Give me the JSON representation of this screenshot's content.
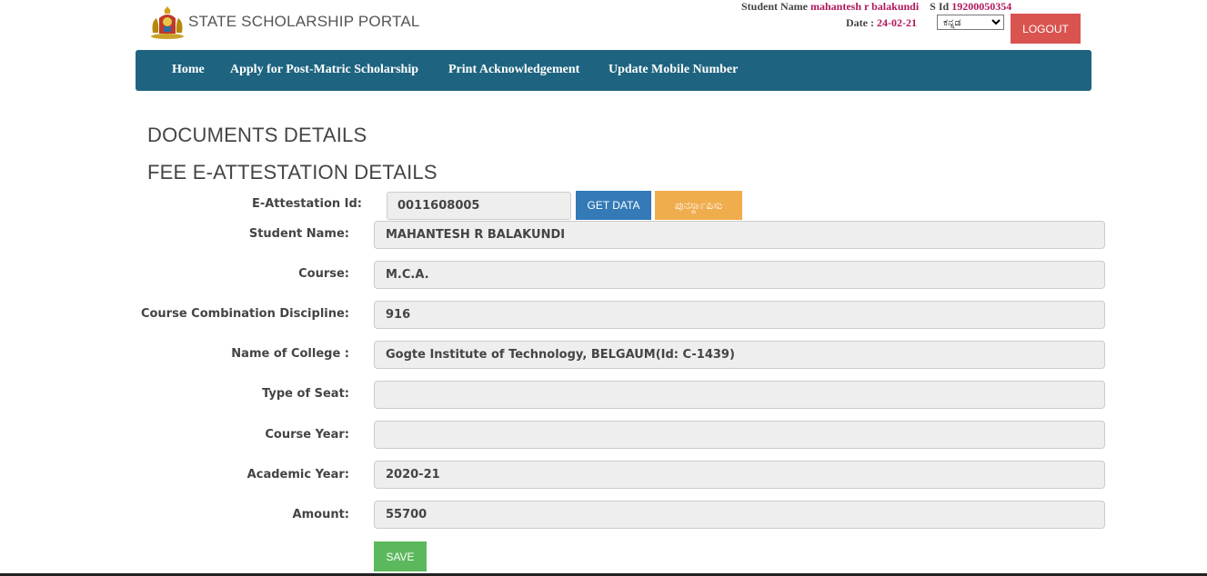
{
  "header": {
    "brand": "STATE SCHOLARSHIP PORTAL",
    "student_name_label": "Student Name",
    "student_name": "mahantesh r balakundi",
    "sid_label": "S Id",
    "sid": "19200050354",
    "date_label": "Date :",
    "date": "24-02-21",
    "language_selected": "ಕನ್ನಡ",
    "logout_label": "LOGOUT"
  },
  "nav": {
    "items": [
      {
        "label": "Home"
      },
      {
        "label": "Apply for Post-Matric Scholarship"
      },
      {
        "label": "Print Acknowledgement"
      },
      {
        "label": "Update Mobile Number"
      }
    ]
  },
  "main": {
    "documents_heading": "DOCUMENTS DETAILS",
    "fee_heading": "FEE E-ATTESTATION DETAILS",
    "attestation_label": "E-Attestation Id:",
    "attestation_value": "0011608005",
    "get_data_label": "GET DATA",
    "reset_label": "ಪುನರ್ಸ್ಥಾಪಿಸು",
    "fields": [
      {
        "label": "Student Name:",
        "value": "MAHANTESH R BALAKUNDI"
      },
      {
        "label": "Course:",
        "value": "M.C.A."
      },
      {
        "label": "Course Combination Discipline:",
        "value": "916"
      },
      {
        "label": "Name of College :",
        "value": "Gogte Institute of Technology, BELGAUM(Id: C-1439)"
      },
      {
        "label": "Type of Seat:",
        "value": ""
      },
      {
        "label": "Course Year:",
        "value": ""
      },
      {
        "label": "Academic Year:",
        "value": "2020-21"
      },
      {
        "label": "Amount:",
        "value": "55700"
      }
    ],
    "save_label": "SAVE"
  },
  "colors": {
    "navbar": "#1e6480",
    "logout": "#d9534f",
    "get_data": "#337ab7",
    "reset": "#f0ad4e",
    "save": "#5cb85c",
    "accent_text": "#b0175d"
  }
}
